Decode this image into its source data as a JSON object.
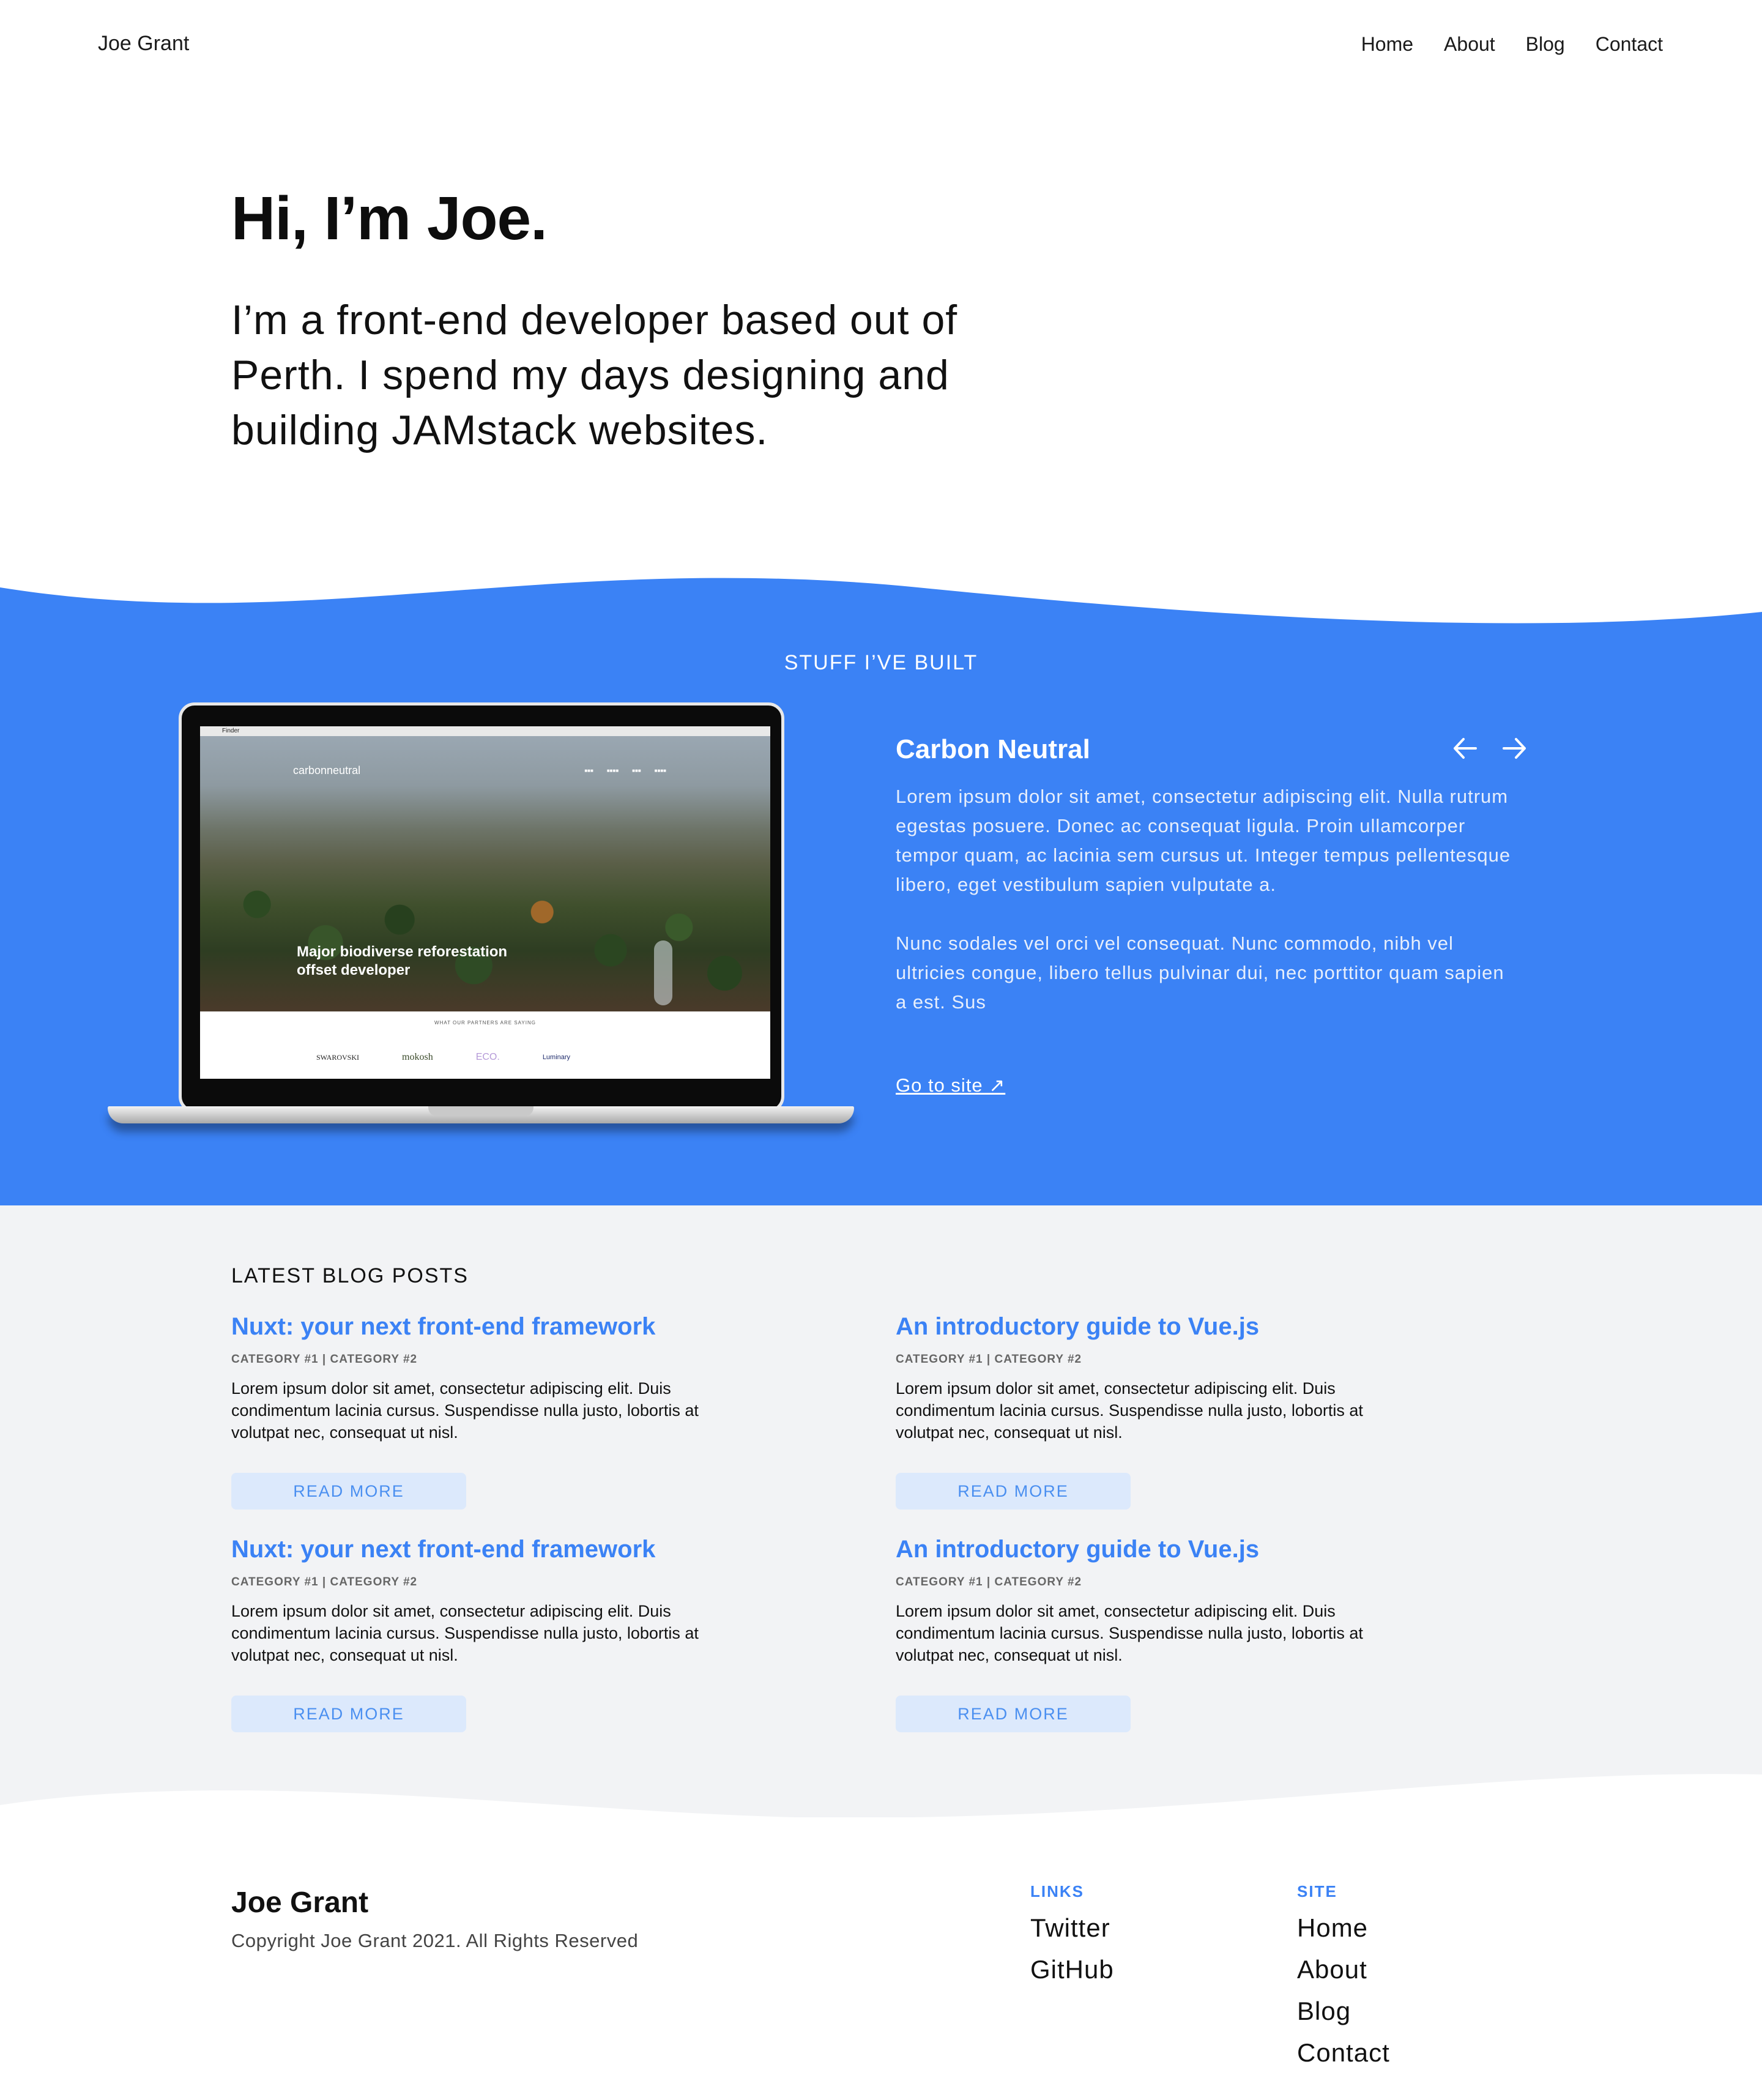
{
  "header": {
    "brand": "Joe Grant",
    "nav": [
      "Home",
      "About",
      "Blog",
      "Contact"
    ]
  },
  "hero": {
    "title": "Hi, I’m Joe.",
    "subtitle": "I’m a front-end developer based out of Perth. I spend my days designing and building JAMstack websites."
  },
  "colors": {
    "accent": "#3b82f5",
    "grey_section": "#f2f3f5",
    "read_more_bg": "#dce9fc"
  },
  "projects": {
    "label": "STUFF I’VE BUILT",
    "title": "Carbon Neutral",
    "prev_icon": "arrow-left-icon",
    "next_icon": "arrow-right-icon",
    "paragraph1": "Lorem ipsum dolor sit amet, consectetur adipiscing elit. Nulla rutrum egestas posuere. Donec ac consequat ligula. Proin ullamcorper tempor quam, ac lacinia sem cursus ut. Integer tempus pellentesque libero, eget vestibulum sapien vulputate a.",
    "paragraph2": "Nunc sodales vel orci vel consequat. Nunc commodo, nibh vel ultricies congue, libero tellus pulvinar dui, nec porttitor quam sapien a est. Sus",
    "link": "Go to site ↗",
    "preview": {
      "menubar": "Finder",
      "logo": "carbonneutral",
      "headline": "Major biodiverse reforestation offset developer",
      "partners_label": "WHAT OUR PARTNERS ARE SAYING",
      "partner_logos": [
        "SWAROVSKI",
        "mokosh",
        "ECO.",
        "Luminary"
      ]
    }
  },
  "blog": {
    "label": "LATEST BLOG POSTS",
    "posts": [
      {
        "title": "Nuxt: your next front-end framework",
        "categories": "CATEGORY #1 | CATEGORY #2",
        "excerpt": "Lorem ipsum dolor sit amet, consectetur adipiscing elit. Duis condimentum lacinia cursus. Suspendisse nulla justo, lobortis at volutpat nec, consequat ut nisl.",
        "button": "READ MORE"
      },
      {
        "title": "An introductory guide to Vue.js",
        "categories": "CATEGORY #1 | CATEGORY #2",
        "excerpt": "Lorem ipsum dolor sit amet, consectetur adipiscing elit. Duis condimentum lacinia cursus. Suspendisse nulla justo, lobortis at volutpat nec, consequat ut nisl.",
        "button": "READ MORE"
      },
      {
        "title": "Nuxt: your next front-end framework",
        "categories": "CATEGORY #1 | CATEGORY #2",
        "excerpt": "Lorem ipsum dolor sit amet, consectetur adipiscing elit. Duis condimentum lacinia cursus. Suspendisse nulla justo, lobortis at volutpat nec, consequat ut nisl.",
        "button": "READ MORE"
      },
      {
        "title": "An introductory guide to Vue.js",
        "categories": "CATEGORY #1 | CATEGORY #2",
        "excerpt": "Lorem ipsum dolor sit amet, consectetur adipiscing elit. Duis condimentum lacinia cursus. Suspendisse nulla justo, lobortis at volutpat nec, consequat ut nisl.",
        "button": "READ MORE"
      }
    ]
  },
  "footer": {
    "name": "Joe Grant",
    "copyright": "Copyright Joe Grant 2021. All Rights Reserved",
    "links_heading": "LINKS",
    "links": [
      "Twitter",
      "GitHub"
    ],
    "site_heading": "SITE",
    "site": [
      "Home",
      "About",
      "Blog",
      "Contact"
    ]
  }
}
